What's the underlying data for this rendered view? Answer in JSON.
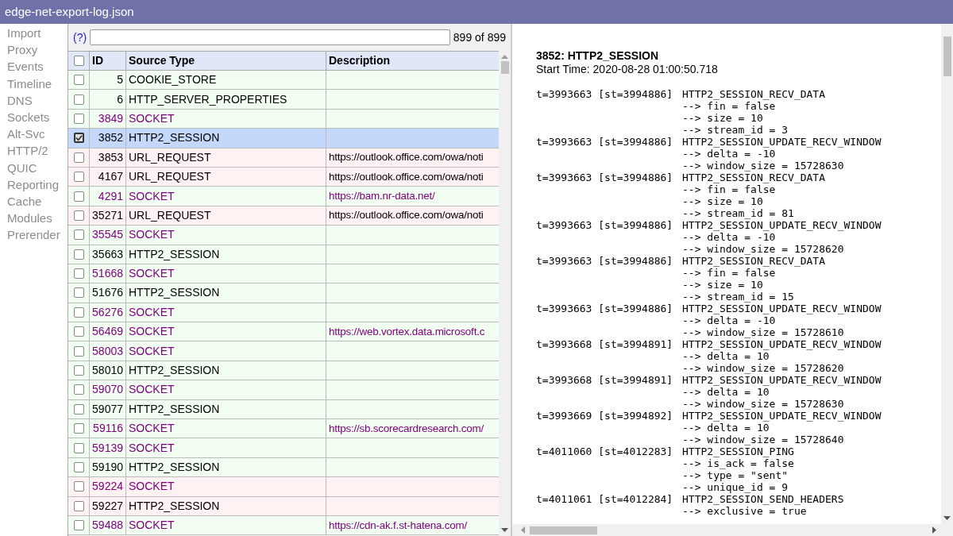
{
  "window": {
    "title": "edge-net-export-log.json"
  },
  "sidebar": {
    "items": [
      {
        "label": "Import"
      },
      {
        "label": "Proxy"
      },
      {
        "label": "Events"
      },
      {
        "label": "Timeline"
      },
      {
        "label": "DNS"
      },
      {
        "label": "Sockets"
      },
      {
        "label": "Alt-Svc"
      },
      {
        "label": "HTTP/2"
      },
      {
        "label": "QUIC"
      },
      {
        "label": "Reporting"
      },
      {
        "label": "Cache"
      },
      {
        "label": "Modules"
      },
      {
        "label": "Prerender"
      }
    ]
  },
  "filter": {
    "help": "(?)",
    "count": "899 of 899"
  },
  "table": {
    "select_all": false,
    "columns": [
      "ID",
      "Source Type",
      "Description"
    ],
    "rows": [
      {
        "id": "5",
        "source_type": "COOKIE_STORE",
        "checked": false,
        "selected": false,
        "error": false,
        "color": "#000000"
      },
      {
        "id": "6",
        "source_type": "HTTP_SERVER_PROPERTIES",
        "checked": false,
        "selected": false,
        "error": false,
        "color": "#000000"
      },
      {
        "id": "3849",
        "source_type": "SOCKET",
        "checked": false,
        "selected": false,
        "error": false,
        "color": "#800080"
      },
      {
        "id": "3852",
        "source_type": "HTTP2_SESSION",
        "checked": true,
        "selected": true,
        "color": "#000000"
      },
      {
        "id": "3853",
        "source_type": "URL_REQUEST",
        "description": "https://outlook.office.com/owa/noti",
        "checked": false,
        "selected": false,
        "error": true,
        "color": "#000000"
      },
      {
        "id": "4167",
        "source_type": "URL_REQUEST",
        "description": "https://outlook.office.com/owa/noti",
        "checked": false,
        "selected": false,
        "error": true,
        "color": "#000000"
      },
      {
        "id": "4291",
        "source_type": "SOCKET",
        "description": "https://bam.nr-data.net/",
        "checked": false,
        "selected": false,
        "error": false,
        "color": "#800080"
      },
      {
        "id": "35271",
        "source_type": "URL_REQUEST",
        "description": "https://outlook.office.com/owa/noti",
        "checked": false,
        "selected": false,
        "error": true,
        "color": "#000000"
      },
      {
        "id": "35545",
        "source_type": "SOCKET",
        "checked": false,
        "selected": false,
        "error": false,
        "color": "#800080"
      },
      {
        "id": "35663",
        "source_type": "HTTP2_SESSION",
        "checked": false,
        "selected": false,
        "error": false,
        "color": "#000000"
      },
      {
        "id": "51668",
        "source_type": "SOCKET",
        "checked": false,
        "selected": false,
        "error": false,
        "color": "#800080"
      },
      {
        "id": "51676",
        "source_type": "HTTP2_SESSION",
        "checked": false,
        "selected": false,
        "error": false,
        "color": "#000000"
      },
      {
        "id": "56276",
        "source_type": "SOCKET",
        "checked": false,
        "selected": false,
        "error": false,
        "color": "#800080"
      },
      {
        "id": "56469",
        "source_type": "SOCKET",
        "description": "https://web.vortex.data.microsoft.c",
        "checked": false,
        "selected": false,
        "error": false,
        "color": "#800080"
      },
      {
        "id": "58003",
        "source_type": "SOCKET",
        "checked": false,
        "selected": false,
        "error": false,
        "color": "#800080"
      },
      {
        "id": "58010",
        "source_type": "HTTP2_SESSION",
        "checked": false,
        "selected": false,
        "error": false,
        "color": "#000000"
      },
      {
        "id": "59070",
        "source_type": "SOCKET",
        "checked": false,
        "selected": false,
        "error": false,
        "color": "#800080"
      },
      {
        "id": "59077",
        "source_type": "HTTP2_SESSION",
        "checked": false,
        "selected": false,
        "error": false,
        "color": "#000000"
      },
      {
        "id": "59116",
        "source_type": "SOCKET",
        "description": "https://sb.scorecardresearch.com/",
        "checked": false,
        "selected": false,
        "error": false,
        "color": "#800080"
      },
      {
        "id": "59139",
        "source_type": "SOCKET",
        "checked": false,
        "selected": false,
        "error": false,
        "color": "#800080"
      },
      {
        "id": "59190",
        "source_type": "HTTP2_SESSION",
        "checked": false,
        "selected": false,
        "error": false,
        "color": "#000000"
      },
      {
        "id": "59224",
        "source_type": "SOCKET",
        "checked": false,
        "selected": false,
        "error": true,
        "color": "#800080"
      },
      {
        "id": "59227",
        "source_type": "HTTP2_SESSION",
        "checked": false,
        "selected": false,
        "error": true,
        "color": "#000000"
      },
      {
        "id": "59488",
        "source_type": "SOCKET",
        "description": "https://cdn-ak.f.st-hatena.com/",
        "checked": false,
        "selected": false,
        "error": false,
        "color": "#800080"
      }
    ]
  },
  "details": {
    "heading": "3852: HTTP2_SESSION",
    "start_time": "Start Time: 2020-08-28 01:00:50.718",
    "entries": [
      {
        "time": "t=3993663 [st=3994886]",
        "event": "HTTP2_SESSION_RECV_DATA",
        "params": [
          "--> fin = false",
          "--> size = 10",
          "--> stream_id = 3"
        ]
      },
      {
        "time": "t=3993663 [st=3994886]",
        "event": "HTTP2_SESSION_UPDATE_RECV_WINDOW",
        "params": [
          "--> delta = -10",
          "--> window_size = 15728630"
        ]
      },
      {
        "time": "t=3993663 [st=3994886]",
        "event": "HTTP2_SESSION_RECV_DATA",
        "params": [
          "--> fin = false",
          "--> size = 10",
          "--> stream_id = 81"
        ]
      },
      {
        "time": "t=3993663 [st=3994886]",
        "event": "HTTP2_SESSION_UPDATE_RECV_WINDOW",
        "params": [
          "--> delta = -10",
          "--> window_size = 15728620"
        ]
      },
      {
        "time": "t=3993663 [st=3994886]",
        "event": "HTTP2_SESSION_RECV_DATA",
        "params": [
          "--> fin = false",
          "--> size = 10",
          "--> stream_id = 15"
        ]
      },
      {
        "time": "t=3993663 [st=3994886]",
        "event": "HTTP2_SESSION_UPDATE_RECV_WINDOW",
        "params": [
          "--> delta = -10",
          "--> window_size = 15728610"
        ]
      },
      {
        "time": "t=3993668 [st=3994891]",
        "event": "HTTP2_SESSION_UPDATE_RECV_WINDOW",
        "params": [
          "--> delta = 10",
          "--> window_size = 15728620"
        ]
      },
      {
        "time": "t=3993668 [st=3994891]",
        "event": "HTTP2_SESSION_UPDATE_RECV_WINDOW",
        "params": [
          "--> delta = 10",
          "--> window_size = 15728630"
        ]
      },
      {
        "time": "t=3993669 [st=3994892]",
        "event": "HTTP2_SESSION_UPDATE_RECV_WINDOW",
        "params": [
          "--> delta = 10",
          "--> window_size = 15728640"
        ]
      },
      {
        "time": "t=4011060 [st=4012283]",
        "event": "HTTP2_SESSION_PING",
        "params": [
          "--> is_ack = false",
          "--> type = \"sent\"",
          "--> unique_id = 9"
        ]
      },
      {
        "time": "t=4011061 [st=4012284]",
        "event": "HTTP2_SESSION_SEND_HEADERS",
        "params": [
          "--> exclusive = true"
        ]
      }
    ]
  }
}
